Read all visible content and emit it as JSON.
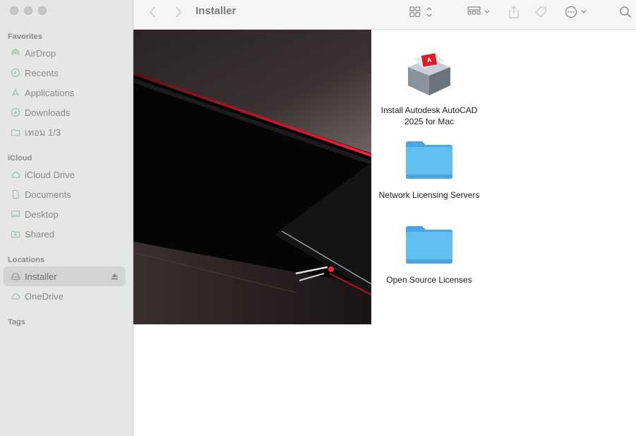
{
  "window": {
    "title": "Installer"
  },
  "sidebar": {
    "sections": [
      {
        "title": "Favorites",
        "items": [
          {
            "label": "AirDrop",
            "icon": "airdrop-icon"
          },
          {
            "label": "Recents",
            "icon": "clock-icon"
          },
          {
            "label": "Applications",
            "icon": "applications-icon"
          },
          {
            "label": "Downloads",
            "icon": "download-icon"
          },
          {
            "label": "เทอม 1/3",
            "icon": "folder-icon"
          }
        ]
      },
      {
        "title": "iCloud",
        "items": [
          {
            "label": "iCloud Drive",
            "icon": "cloud-icon"
          },
          {
            "label": "Documents",
            "icon": "document-icon"
          },
          {
            "label": "Desktop",
            "icon": "desktop-icon"
          },
          {
            "label": "Shared",
            "icon": "shared-folder-icon"
          }
        ]
      },
      {
        "title": "Locations",
        "items": [
          {
            "label": "Installer",
            "icon": "drive-icon",
            "selected": true
          },
          {
            "label": "OneDrive",
            "icon": "cloud-icon"
          }
        ]
      },
      {
        "title": "Tags",
        "items": []
      }
    ]
  },
  "files": [
    {
      "name_line1": "Install Autodesk AutoCAD",
      "name_line2": "2025 for Mac",
      "icon": "installer-package-icon"
    },
    {
      "name_line1": "Network Licensing Servers",
      "icon": "folder-icon"
    },
    {
      "name_line1": "Open Source Licenses",
      "icon": "folder-icon"
    }
  ],
  "colors": {
    "folder": "#5ab4ec",
    "folder_tab": "#4aa6e0",
    "accent_red": "#c8102e",
    "sidebar_bg": "#e6e6e6"
  }
}
